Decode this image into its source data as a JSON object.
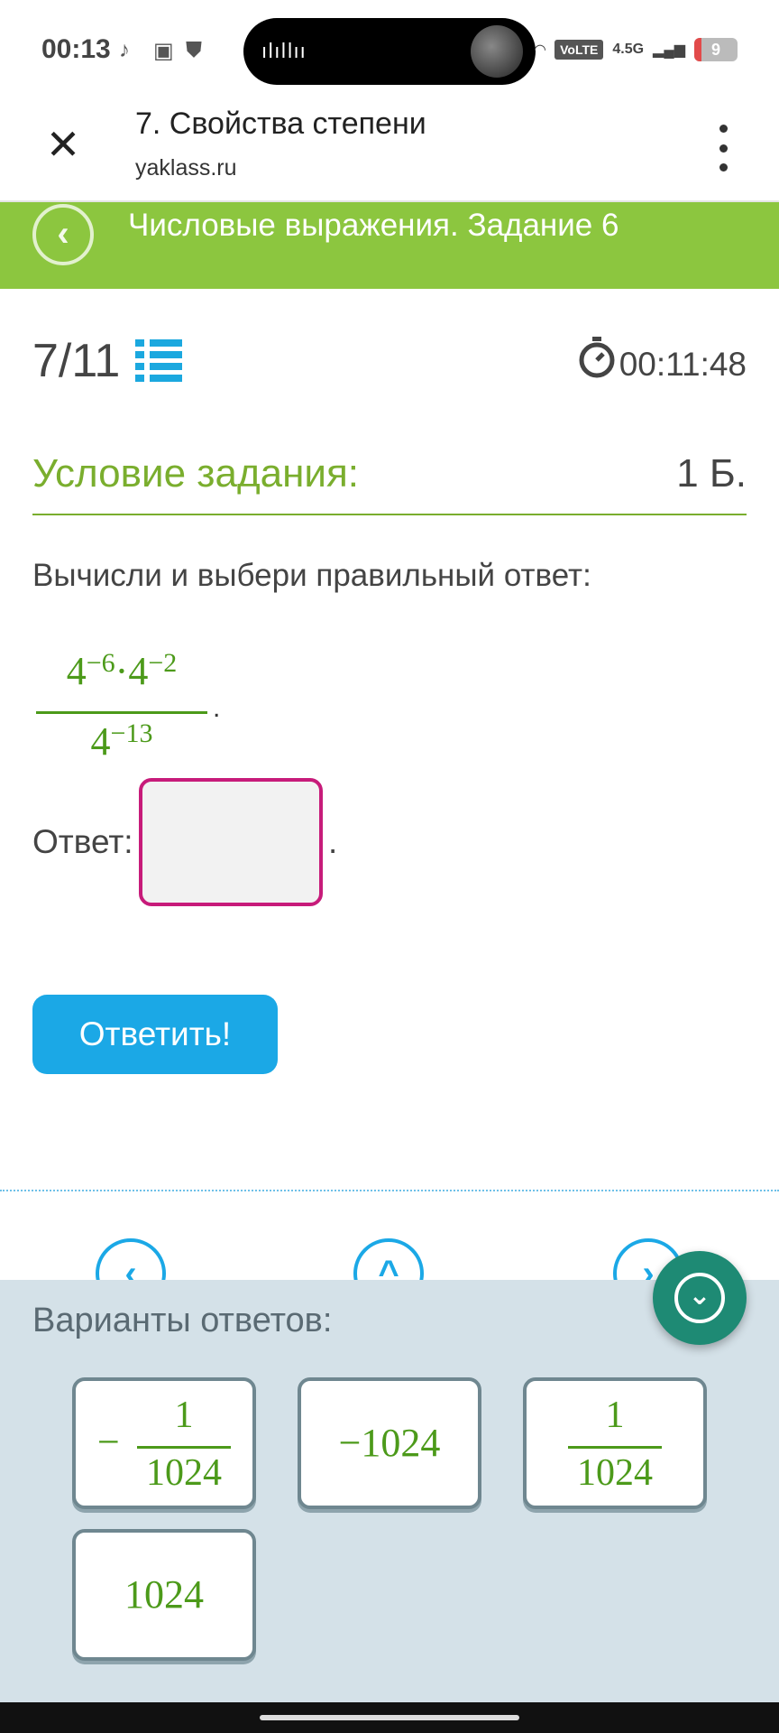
{
  "status_bar": {
    "time": "00:13",
    "volte": "VoLTE",
    "network": "4.5G",
    "battery": "9",
    "audio_wave": "ılıllıı"
  },
  "app_bar": {
    "close_icon": "✕",
    "title": "7. Свойства степени",
    "url": "yaklass.ru"
  },
  "banner": {
    "back_icon": "‹",
    "title": "Числовые выражения. Задание 6"
  },
  "progress": {
    "counter": "7/11",
    "timer": "00:11:48"
  },
  "condition": {
    "heading": "Условие задания:",
    "points": "1 Б.",
    "instruction": "Вычисли и выбери правильный ответ:"
  },
  "expression": {
    "num_base1": "4",
    "num_exp1": "−6",
    "dot": "·",
    "num_base2": "4",
    "num_exp2": "−2",
    "den_base": "4",
    "den_exp": "−13",
    "trailing": "."
  },
  "answer": {
    "label": "Ответ:",
    "value": "",
    "trailing": "."
  },
  "submit_label": "Ответить!",
  "nav": {
    "prev_icon": "‹",
    "up_icon": "^",
    "next_icon": "›"
  },
  "variants": {
    "title": "Варианты ответов:",
    "fab_icon": "⌄",
    "options": [
      {
        "sign": "−",
        "numerator": "1",
        "denominator": "1024"
      },
      {
        "value": "−1024"
      },
      {
        "sign": "",
        "numerator": "1",
        "denominator": "1024"
      },
      {
        "value": "1024"
      }
    ]
  },
  "colors": {
    "accent_green": "#8cc63f",
    "math_green": "#4c9a1a",
    "button_blue": "#1ba8e6",
    "input_border": "#c71b7a",
    "fab_teal": "#1e8a74"
  }
}
